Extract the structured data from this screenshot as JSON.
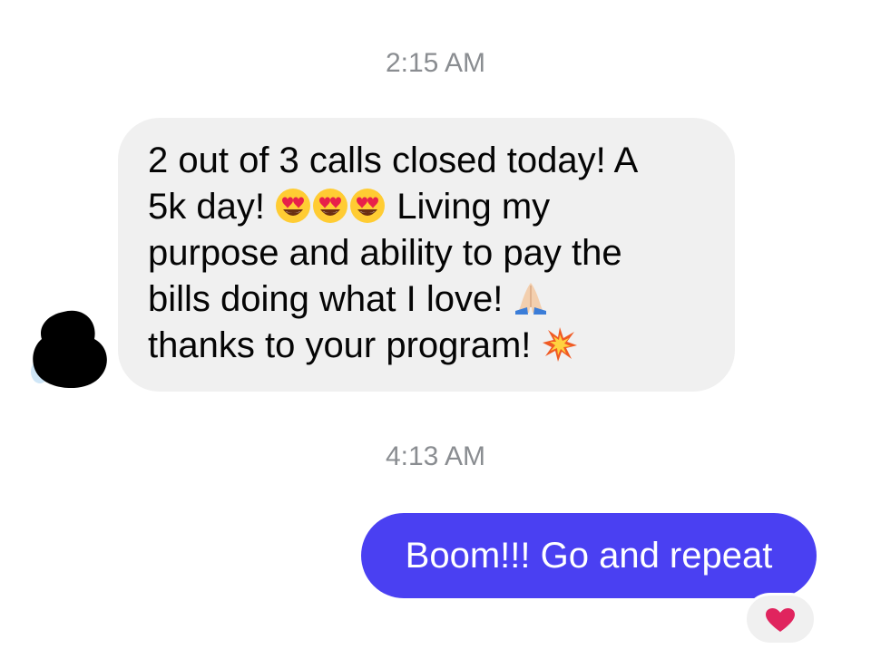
{
  "thread": {
    "timestamp_1": "2:15 AM",
    "timestamp_2": "4:13 AM"
  },
  "incoming_message": {
    "line_1": "2 out of 3 calls closed today! A",
    "line_2_a": "5k day! ",
    "line_2_b": " Living my",
    "line_3": "purpose and ability to pay the",
    "line_4": "bills doing what I love! ",
    "line_5": "thanks to your program! ",
    "emojis": [
      "heart-eyes-emoji",
      "heart-eyes-emoji",
      "heart-eyes-emoji",
      "folded-hands-emoji",
      "collision-emoji"
    ]
  },
  "outgoing_message": {
    "text": "Boom!!! Go and repeat",
    "reaction": "red-heart-emoji"
  },
  "colors": {
    "incoming_bubble": "#f0f0f0",
    "outgoing_bubble": "#4a40f2",
    "timestamp_text": "#8a8d91",
    "heart": "#e0245e"
  }
}
